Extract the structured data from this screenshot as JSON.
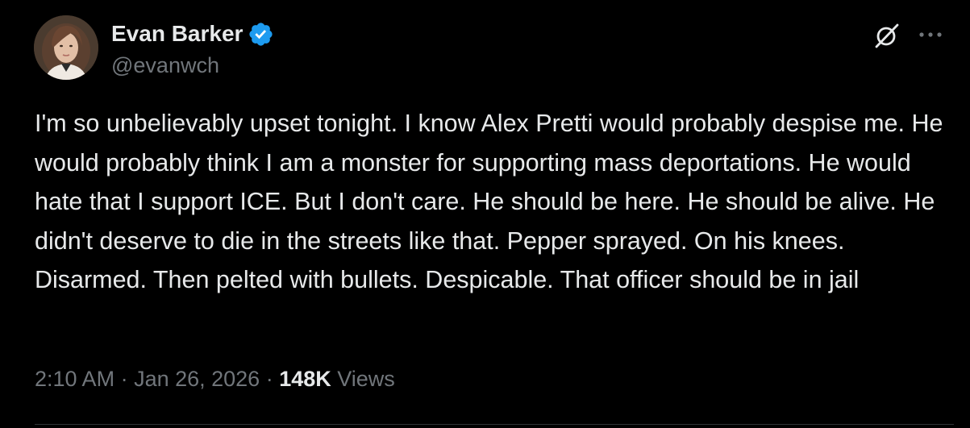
{
  "author": {
    "display_name": "Evan Barker",
    "handle": "@evanwch",
    "verified": true,
    "verified_color": "#1d9bf0"
  },
  "actions": {
    "grok_icon": "grok-icon",
    "more_icon": "more-options-icon"
  },
  "tweet": {
    "text": "I'm so unbelievably upset tonight. I know Alex Pretti would probably despise me. He would probably think I am a monster for supporting mass deportations. He would hate that I support ICE. But I don't care. He should be here. He should be alive. He didn't deserve to die in the streets like that. Pepper sprayed. On his knees. Disarmed. Then pelted with bullets. Despicable. That officer should be in jail"
  },
  "meta": {
    "time": "2:10 AM",
    "separator": " · ",
    "date": "Jan 26, 2026",
    "views_count": "148K",
    "views_label": "Views"
  },
  "colors": {
    "background": "#000000",
    "primary_text": "#e7e9ea",
    "secondary_text": "#71767b",
    "divider": "#2f3336"
  }
}
